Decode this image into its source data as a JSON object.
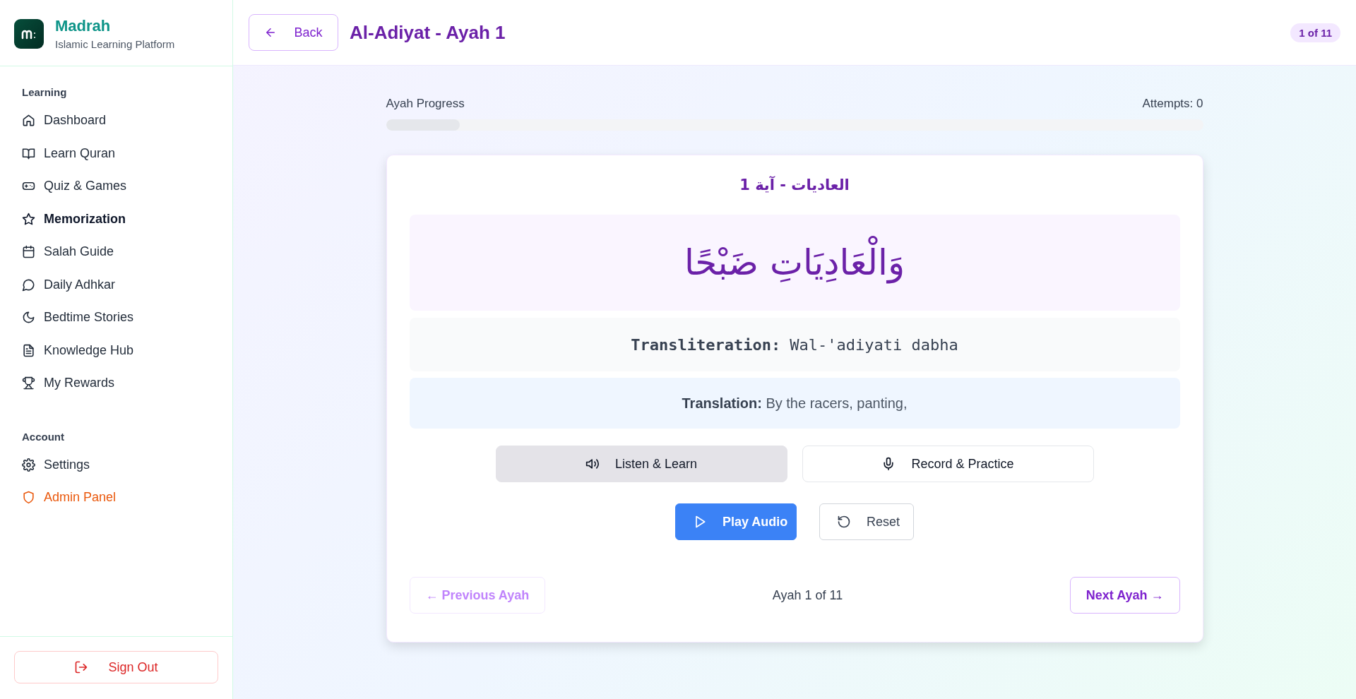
{
  "brand": {
    "name": "Madrah",
    "tagline": "Islamic Learning Platform"
  },
  "sidebar": {
    "sections": [
      {
        "title": "Learning",
        "items": [
          {
            "label": "Dashboard",
            "selected": false,
            "kind": "normal"
          },
          {
            "label": "Learn Quran",
            "selected": false,
            "kind": "normal"
          },
          {
            "label": "Quiz & Games",
            "selected": false,
            "kind": "normal"
          },
          {
            "label": "Memorization",
            "selected": true,
            "kind": "normal"
          },
          {
            "label": "Salah Guide",
            "selected": false,
            "kind": "normal"
          },
          {
            "label": "Daily Adhkar",
            "selected": false,
            "kind": "normal"
          },
          {
            "label": "Bedtime Stories",
            "selected": false,
            "kind": "normal"
          },
          {
            "label": "Knowledge Hub",
            "selected": false,
            "kind": "normal"
          },
          {
            "label": "My Rewards",
            "selected": false,
            "kind": "normal"
          }
        ]
      },
      {
        "title": "Account",
        "items": [
          {
            "label": "Settings",
            "selected": false,
            "kind": "normal"
          },
          {
            "label": "Admin Panel",
            "selected": false,
            "kind": "admin"
          }
        ]
      }
    ],
    "sign_out": "Sign Out"
  },
  "header": {
    "back": "Back",
    "title": "Al-Adiyat - Ayah 1",
    "badge": "1 of 11"
  },
  "progress": {
    "label": "Ayah Progress",
    "attempts": "Attempts: 0",
    "level": 0.09
  },
  "card": {
    "heading": "العاديات - آية 1",
    "arabic": "وَالْعَادِيَاتِ ضَبْحًا",
    "transliteration": "**Transliteration:** Wal-'adiyati dabha",
    "translation": "**Translation:** By the racers, panting,",
    "modes": [
      {
        "label": "Listen & Learn",
        "selected": true
      },
      {
        "label": "Record & Practice",
        "selected": false
      }
    ],
    "actions": [
      {
        "label": "Play Audio",
        "kind": "primary"
      },
      {
        "label": "Reset",
        "kind": "secondary"
      }
    ],
    "nav": {
      "previous": {
        "label": "← Previous Ayah",
        "disabled": true
      },
      "position": "Ayah 1 of 11",
      "next": {
        "label": "Next Ayah →",
        "disabled": false
      }
    }
  }
}
